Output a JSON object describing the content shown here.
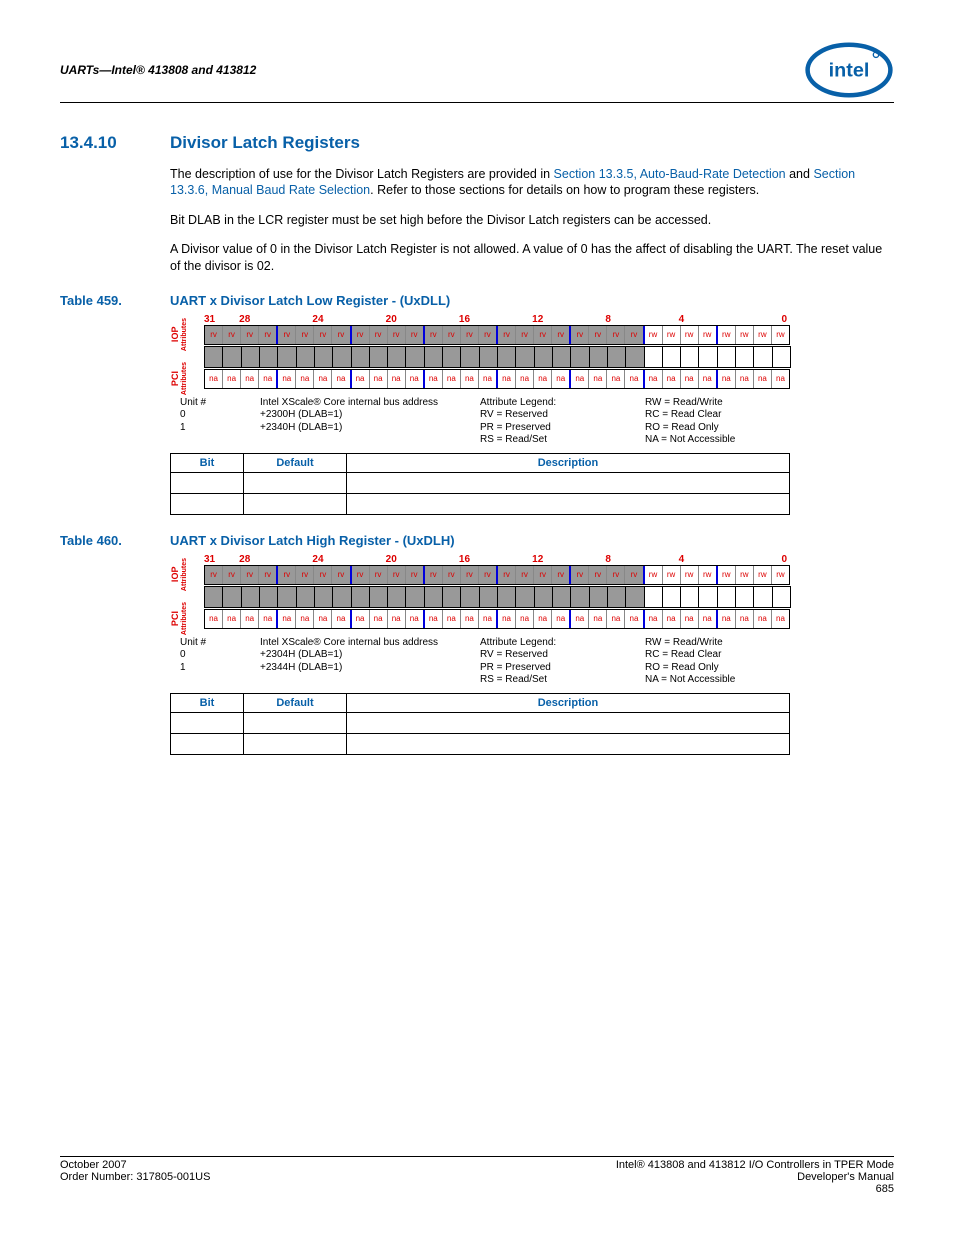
{
  "header": {
    "text": "UARTs—Intel® 413808 and 413812"
  },
  "section": {
    "number": "13.4.10",
    "title": "Divisor Latch Registers"
  },
  "para1_a": "The description of use for the Divisor Latch Registers are provided in ",
  "para1_link1": "Section 13.3.5, Auto-Baud-Rate Detection",
  "para1_mid": " and ",
  "para1_link2": "Section 13.3.6, Manual Baud Rate Selection",
  "para1_b": ". Refer to those sections for details on how to program these registers.",
  "para2": "Bit DLAB in the LCR register must be set high before the Divisor Latch registers can be accessed.",
  "para3": "A Divisor value of 0 in the Divisor Latch Register is not allowed. A value of 0 has the affect of disabling the UART. The reset value of the divisor is 02.",
  "table459": {
    "num": "Table 459.",
    "title": "UART x Divisor Latch Low Register - (UxDLL)",
    "bit_numbers": [
      "31",
      "28",
      "24",
      "20",
      "16",
      "12",
      "8",
      "4",
      "0"
    ],
    "iop_label": "IOP",
    "pci_label": "PCI",
    "attr_label": "Attributes",
    "iop_attrs_rv_count": 24,
    "iop_attrs_rw_count": 8,
    "pci_attrs_na_count": 32,
    "unit_col": "Unit #\n0\n1",
    "addr_col": "Intel XScale® Core internal bus address\n+2300H (DLAB=1)\n+2340H (DLAB=1)",
    "legend_col": "Attribute Legend:\nRV = Reserved\nPR = Preserved\nRS = Read/Set",
    "rw_col": "RW = Read/Write\nRC = Read Clear\nRO = Read Only\nNA = Not Accessible",
    "th_bit": "Bit",
    "th_default": "Default",
    "th_desc": "Description"
  },
  "table460": {
    "num": "Table 460.",
    "title": "UART x Divisor Latch High Register - (UxDLH)",
    "addr_col": "Intel XScale® Core internal bus address\n+2304H (DLAB=1)\n+2344H (DLAB=1)"
  },
  "footer": {
    "left1": "October 2007",
    "left2": "Order Number: 317805-001US",
    "right1": "Intel® 413808 and 413812 I/O Controllers in TPER Mode",
    "right2": "Developer's Manual",
    "right3": "685"
  }
}
